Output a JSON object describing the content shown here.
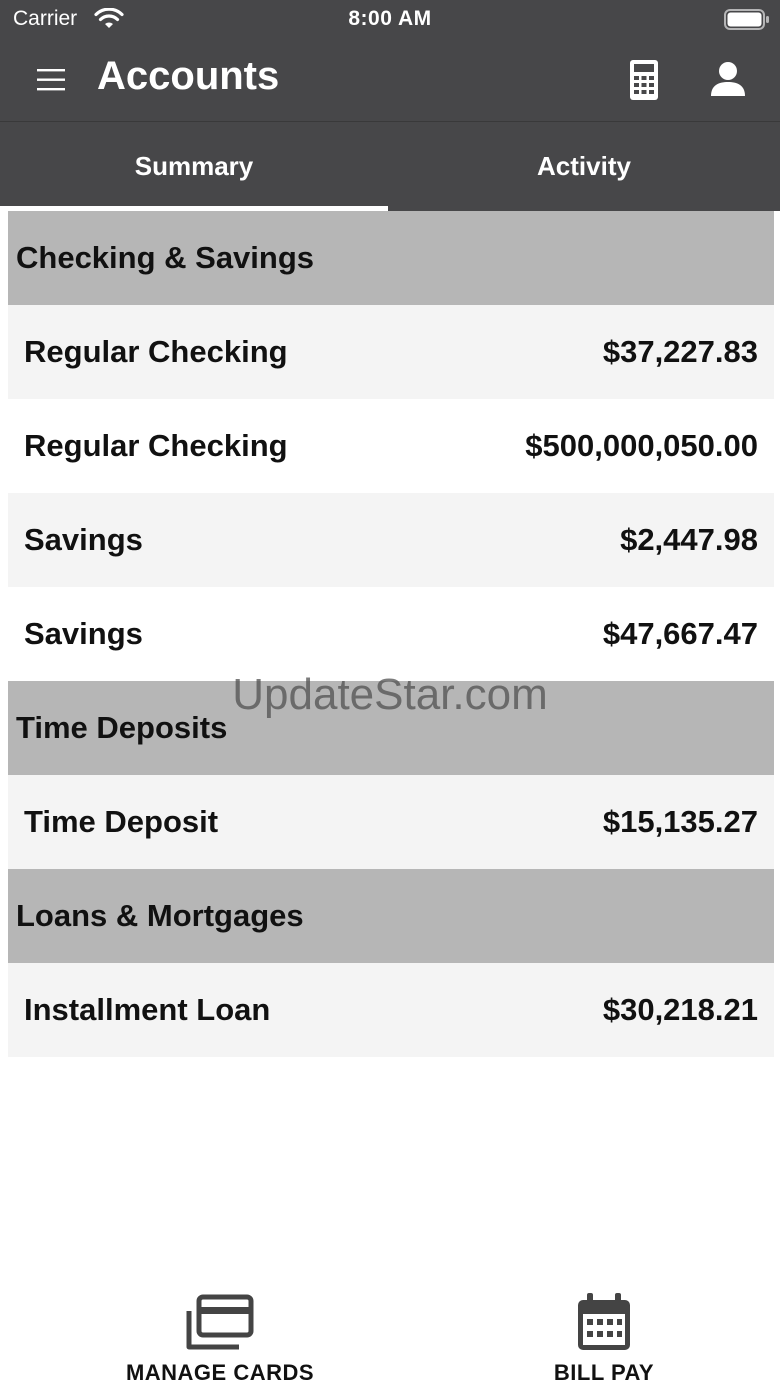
{
  "status_bar": {
    "carrier": "Carrier",
    "time": "8:00 AM",
    "wifi_icon": "wifi-icon",
    "battery_icon": "battery-icon"
  },
  "header": {
    "title": "Accounts",
    "menu_icon": "hamburger-menu-icon",
    "calculator_icon": "calculator-icon",
    "profile_icon": "user-profile-icon",
    "background_color": "#474749"
  },
  "tabs": [
    {
      "label": "Summary",
      "selected": true
    },
    {
      "label": "Activity",
      "selected": false
    }
  ],
  "sections": [
    {
      "title": "Checking & Savings",
      "accounts": [
        {
          "name": "Regular Checking",
          "balance": "$37,227.83"
        },
        {
          "name": "Regular Checking",
          "balance": "$500,000,050.00"
        },
        {
          "name": "Savings",
          "balance": "$2,447.98"
        },
        {
          "name": "Savings",
          "balance": "$47,667.47"
        }
      ]
    },
    {
      "title": "Time Deposits",
      "accounts": [
        {
          "name": "Time Deposit",
          "balance": "$15,135.27"
        }
      ]
    },
    {
      "title": "Loans & Mortgages",
      "accounts": [
        {
          "name": "Installment Loan",
          "balance": "$30,218.21"
        }
      ]
    }
  ],
  "watermark": "UpdateStar.com",
  "bottom_nav": {
    "manage_cards": {
      "label": "MANAGE CARDS",
      "icon": "credit-cards-icon"
    },
    "bill_pay": {
      "label": "BILL PAY",
      "icon": "calendar-icon"
    }
  }
}
